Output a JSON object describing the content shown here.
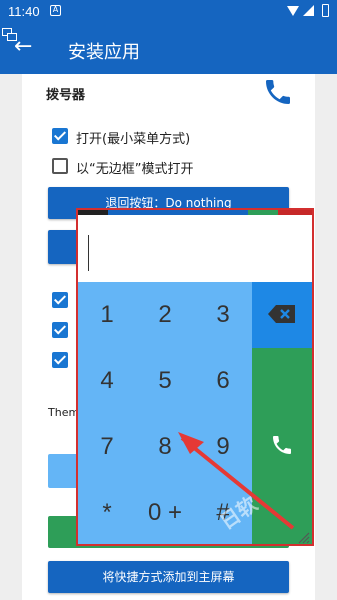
{
  "status_bar": {
    "time": "11:40"
  },
  "app_bar": {
    "title": "安装应用"
  },
  "section": {
    "title": "拨号器"
  },
  "checkboxes": [
    {
      "label": "打开(最小菜单方式)",
      "checked": true
    },
    {
      "label": "以“无边框”模式打开",
      "checked": false
    }
  ],
  "back_button": {
    "label": "退回按钮：Do nothing"
  },
  "partial_checkboxes": [
    {
      "checked": true
    },
    {
      "checked": true
    },
    {
      "checked": true
    }
  ],
  "theme_label": "Them",
  "bottom_button": {
    "label": "将快捷方式添加到主屏幕"
  },
  "dialer": {
    "keys": [
      "1",
      "2",
      "3",
      "4",
      "5",
      "6",
      "7",
      "8",
      "9",
      "*",
      "0 +",
      "#"
    ],
    "input_value": ""
  },
  "watermark_text": "日软",
  "colors": {
    "primary": "#1565c0",
    "keypad": "#64b5f6",
    "delete_bg": "#1e88e5",
    "call_bg": "#2e9e58",
    "annotation": "#d32f2f"
  }
}
